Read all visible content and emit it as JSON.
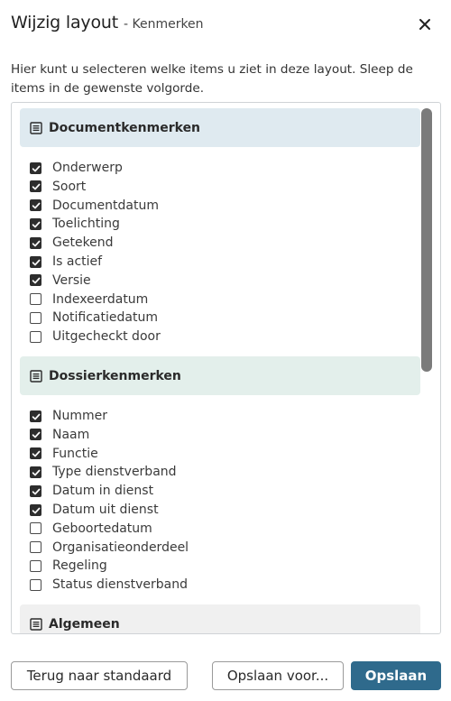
{
  "dialog": {
    "title": "Wijzig layout",
    "subtitle": "- Kenmerken",
    "close_icon": "close-icon",
    "description": "Hier kunt u selecteren welke items u ziet in deze layout. Sleep de items in de gewenste volgorde."
  },
  "sections": [
    {
      "title": "Documentkenmerken",
      "icon": "list-icon",
      "color": "#dfeaf0",
      "items": [
        {
          "label": "Onderwerp",
          "checked": true
        },
        {
          "label": "Soort",
          "checked": true
        },
        {
          "label": "Documentdatum",
          "checked": true
        },
        {
          "label": "Toelichting",
          "checked": true
        },
        {
          "label": "Getekend",
          "checked": true
        },
        {
          "label": "Is actief",
          "checked": true
        },
        {
          "label": "Versie",
          "checked": true
        },
        {
          "label": "Indexeerdatum",
          "checked": false
        },
        {
          "label": "Notificatiedatum",
          "checked": false
        },
        {
          "label": "Uitgecheckt door",
          "checked": false
        }
      ]
    },
    {
      "title": "Dossierkenmerken",
      "icon": "list-icon",
      "color": "#e3efeb",
      "items": [
        {
          "label": "Nummer",
          "checked": true
        },
        {
          "label": "Naam",
          "checked": true
        },
        {
          "label": "Functie",
          "checked": true
        },
        {
          "label": "Type dienstverband",
          "checked": true
        },
        {
          "label": "Datum in dienst",
          "checked": true
        },
        {
          "label": "Datum uit dienst",
          "checked": true
        },
        {
          "label": "Geboortedatum",
          "checked": false
        },
        {
          "label": "Organisatieonderdeel",
          "checked": false
        },
        {
          "label": "Regeling",
          "checked": false
        },
        {
          "label": "Status dienstverband",
          "checked": false
        }
      ]
    },
    {
      "title": "Algemeen",
      "icon": "list-icon",
      "color": "#f0f0f0",
      "items": []
    }
  ],
  "footer": {
    "reset_label": "Terug naar standaard",
    "save_as_label": "Opslaan voor...",
    "save_label": "Opslaan"
  },
  "colors": {
    "primary": "#2f6a8c"
  }
}
